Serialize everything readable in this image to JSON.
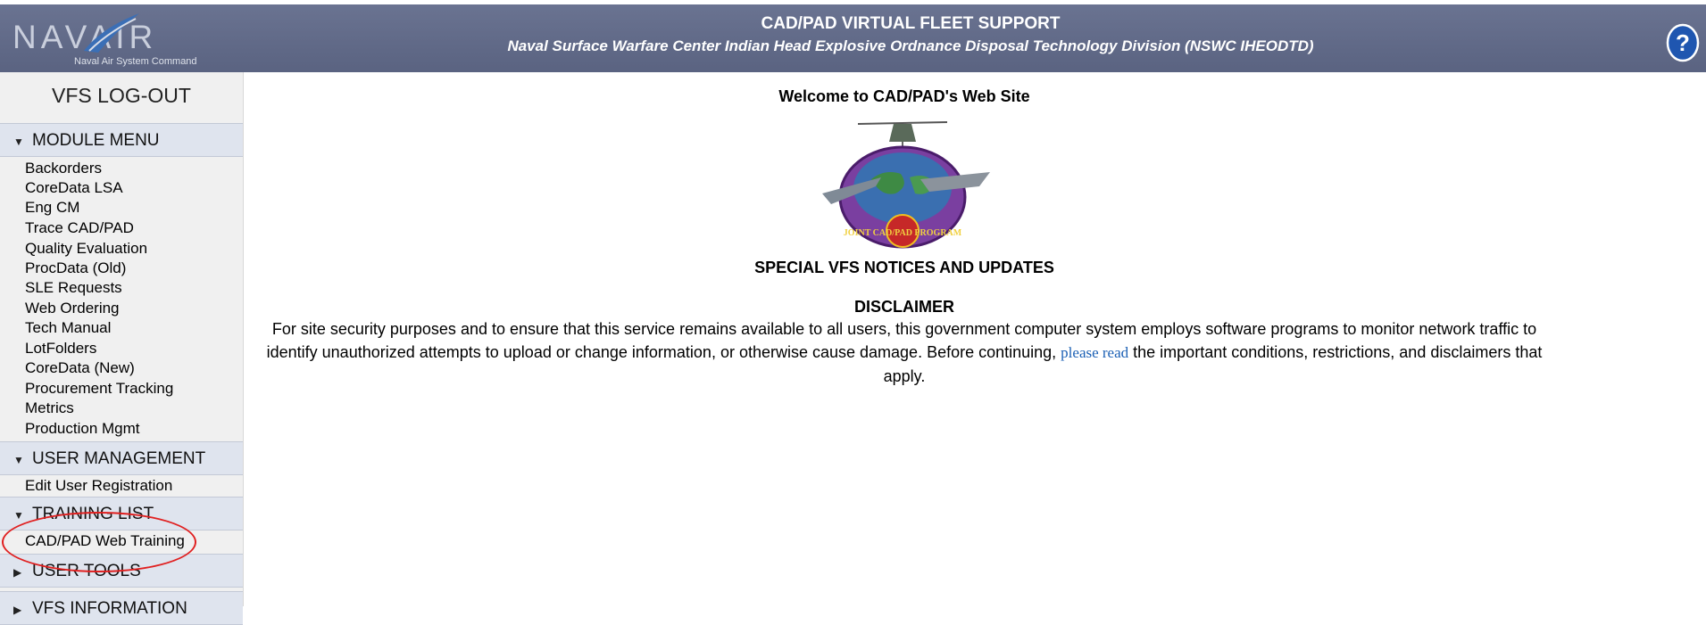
{
  "header": {
    "logo_text": "NAVAIR",
    "logo_subtitle": "Naval Air System Command",
    "title": "CAD/PAD VIRTUAL FLEET SUPPORT",
    "subtitle": "Naval Surface Warfare Center Indian Head Explosive Ordnance Disposal Technology Division (NSWC IHEODTD)",
    "help_icon": "question-mark-icon"
  },
  "sidebar": {
    "logout": "VFS LOG-OUT",
    "module_menu": {
      "label": "MODULE MENU",
      "items": [
        "Backorders",
        "CoreData LSA",
        "Eng CM",
        "Trace CAD/PAD",
        "Quality Evaluation",
        "ProcData (Old)",
        "SLE Requests",
        "Web Ordering",
        "Tech Manual",
        "LotFolders",
        "CoreData (New)",
        "Procurement Tracking",
        "Metrics",
        "Production Mgmt"
      ]
    },
    "user_management": {
      "label": "USER MANAGEMENT",
      "items": [
        "Edit User Registration"
      ]
    },
    "training_list": {
      "label": "TRAINING LIST",
      "items": [
        "CAD/PAD Web Training"
      ]
    },
    "user_tools": {
      "label": "USER TOOLS"
    },
    "vfs_information": {
      "label": "VFS INFORMATION"
    }
  },
  "main": {
    "welcome": "Welcome to CAD/PAD's Web Site",
    "emblem_text": "JOINT CAD/PAD PROGRAM",
    "notices_heading": "SPECIAL VFS NOTICES AND UPDATES",
    "disclaimer_title": "DISCLAIMER",
    "disclaimer_before": "For site security purposes and to ensure that this service remains available to all users, this government computer system employs software programs to monitor network traffic to identify unauthorized attempts to upload or change information, or otherwise cause damage. Before continuing, ",
    "disclaimer_link": "please read",
    "disclaimer_after": " the important conditions, restrictions, and disclaimers that apply."
  },
  "colors": {
    "header_bg": "#5f6886",
    "section_bg": "#dfe4ee",
    "link": "#1a5fb4",
    "annotation": "#e02020"
  }
}
